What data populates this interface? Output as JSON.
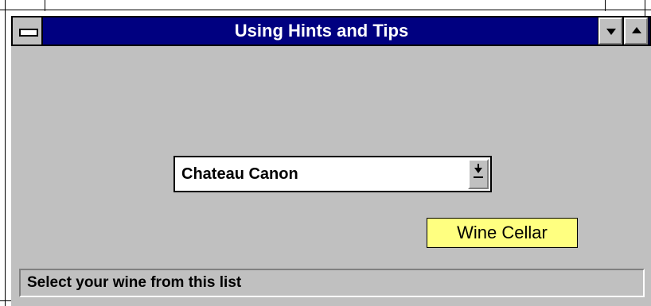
{
  "window": {
    "title": "Using Hints and Tips"
  },
  "combo": {
    "selected_value": "Chateau Canon"
  },
  "tooltip": {
    "text": "Wine Cellar"
  },
  "statusbar": {
    "text": "Select your wine from this list"
  },
  "colors": {
    "titlebar": "#000080",
    "face": "#c0c0c0",
    "tooltip": "#ffff80"
  }
}
